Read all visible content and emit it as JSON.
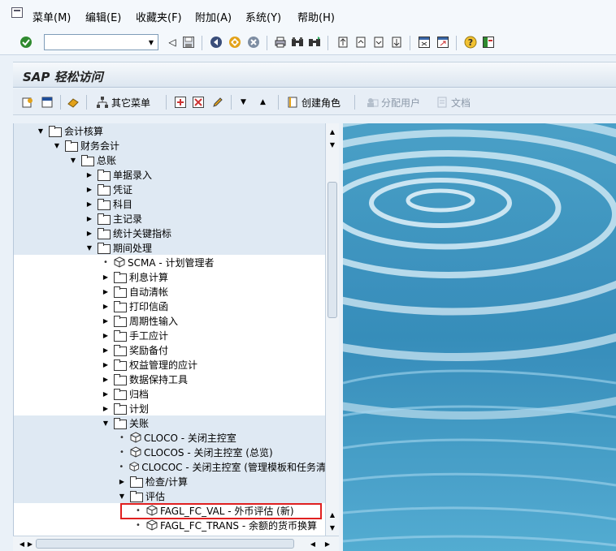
{
  "menubar": {
    "items": [
      "菜单(M)",
      "编辑(E)",
      "收藏夹(F)",
      "附加(A)",
      "系统(Y)",
      "帮助(H)"
    ]
  },
  "toolbar": {
    "command_value": ""
  },
  "title": "SAP 轻松访问",
  "apptoolbar": {
    "other_menu": "其它菜单",
    "create_role": "创建角色",
    "assign_user": "分配用户",
    "documentation": "文档"
  },
  "tree": {
    "rows": [
      {
        "label": "会计核算",
        "type": "folder",
        "state": "open",
        "level": 0
      },
      {
        "label": "财务会计",
        "type": "folder",
        "state": "open",
        "level": 1
      },
      {
        "label": "总账",
        "type": "folder",
        "state": "open",
        "level": 2
      },
      {
        "label": "单据录入",
        "type": "folder",
        "state": "closed",
        "level": 3
      },
      {
        "label": "凭证",
        "type": "folder",
        "state": "closed",
        "level": 3
      },
      {
        "label": "科目",
        "type": "folder",
        "state": "closed",
        "level": 3
      },
      {
        "label": "主记录",
        "type": "folder",
        "state": "closed",
        "level": 3
      },
      {
        "label": "统计关键指标",
        "type": "folder",
        "state": "closed",
        "level": 3
      },
      {
        "label": "期间处理",
        "type": "folder",
        "state": "open",
        "level": 3
      },
      {
        "label": "SCMA - 计划管理者",
        "type": "tx",
        "level": 4
      },
      {
        "label": "利息计算",
        "type": "folder",
        "state": "closed",
        "level": 4
      },
      {
        "label": "自动清帐",
        "type": "folder",
        "state": "closed",
        "level": 4
      },
      {
        "label": "打印信函",
        "type": "folder",
        "state": "closed",
        "level": 4
      },
      {
        "label": "周期性输入",
        "type": "folder",
        "state": "closed",
        "level": 4
      },
      {
        "label": "手工应计",
        "type": "folder",
        "state": "closed",
        "level": 4
      },
      {
        "label": "奖励备付",
        "type": "folder",
        "state": "closed",
        "level": 4
      },
      {
        "label": "权益管理的应计",
        "type": "folder",
        "state": "closed",
        "level": 4
      },
      {
        "label": "数据保持工具",
        "type": "folder",
        "state": "closed",
        "level": 4
      },
      {
        "label": "归档",
        "type": "folder",
        "state": "closed",
        "level": 4
      },
      {
        "label": "计划",
        "type": "folder",
        "state": "closed",
        "level": 4
      },
      {
        "label": "关账",
        "type": "folder",
        "state": "open",
        "level": 4
      },
      {
        "label": "CLOCO - 关闭主控室",
        "type": "tx",
        "level": 5
      },
      {
        "label": "CLOCOS - 关闭主控室 (总览)",
        "type": "tx",
        "level": 5
      },
      {
        "label": "CLOCOC - 关闭主控室 (管理模板和任务清",
        "type": "tx",
        "level": 5
      },
      {
        "label": "检查/计算",
        "type": "folder",
        "state": "closed",
        "level": 5
      },
      {
        "label": "评估",
        "type": "folder",
        "state": "open",
        "level": 5
      },
      {
        "label": "FAGL_FC_VAL - 外币评估 (新)",
        "type": "tx",
        "level": 6
      },
      {
        "label": "FAGL_FC_TRANS - 余额的货币换算",
        "type": "tx",
        "level": 6
      }
    ]
  },
  "colors": {
    "highlight": "#e02020",
    "band": "#dfe9f3",
    "water": "#2e8dbb"
  }
}
